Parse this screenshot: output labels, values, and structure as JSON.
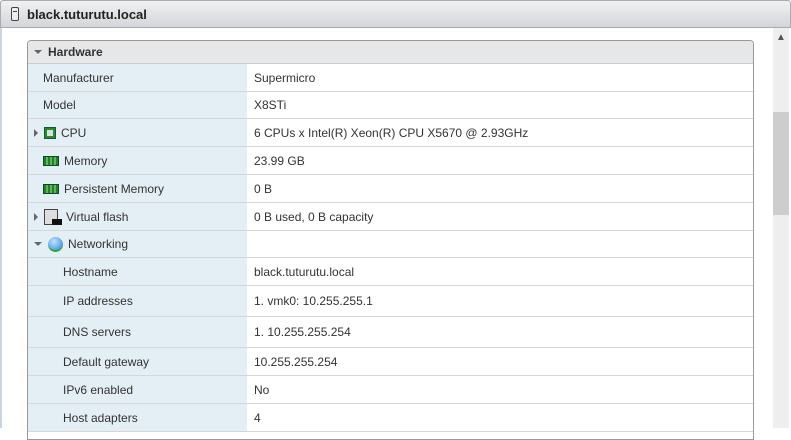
{
  "window": {
    "title": "black.tuturutu.local"
  },
  "section": {
    "title": "Hardware"
  },
  "rows": [
    {
      "label": "Manufacturer",
      "value": "Supermicro"
    },
    {
      "label": "Model",
      "value": "X8STi"
    },
    {
      "label": "CPU",
      "value": "6 CPUs x Intel(R) Xeon(R) CPU X5670 @ 2.93GHz"
    },
    {
      "label": "Memory",
      "value": "23.99 GB"
    },
    {
      "label": "Persistent Memory",
      "value": "0 B"
    },
    {
      "label": "Virtual flash",
      "value": "0 B used, 0 B capacity"
    },
    {
      "label": "Networking",
      "value": ""
    },
    {
      "label": "Hostname",
      "value": "black.tuturutu.local"
    },
    {
      "label": "IP addresses",
      "value": "1. vmk0: 10.255.255.1"
    },
    {
      "label": "DNS servers",
      "value": "1. 10.255.255.254"
    },
    {
      "label": "Default gateway",
      "value": "10.255.255.254"
    },
    {
      "label": "IPv6 enabled",
      "value": "No"
    },
    {
      "label": "Host adapters",
      "value": "4"
    }
  ]
}
